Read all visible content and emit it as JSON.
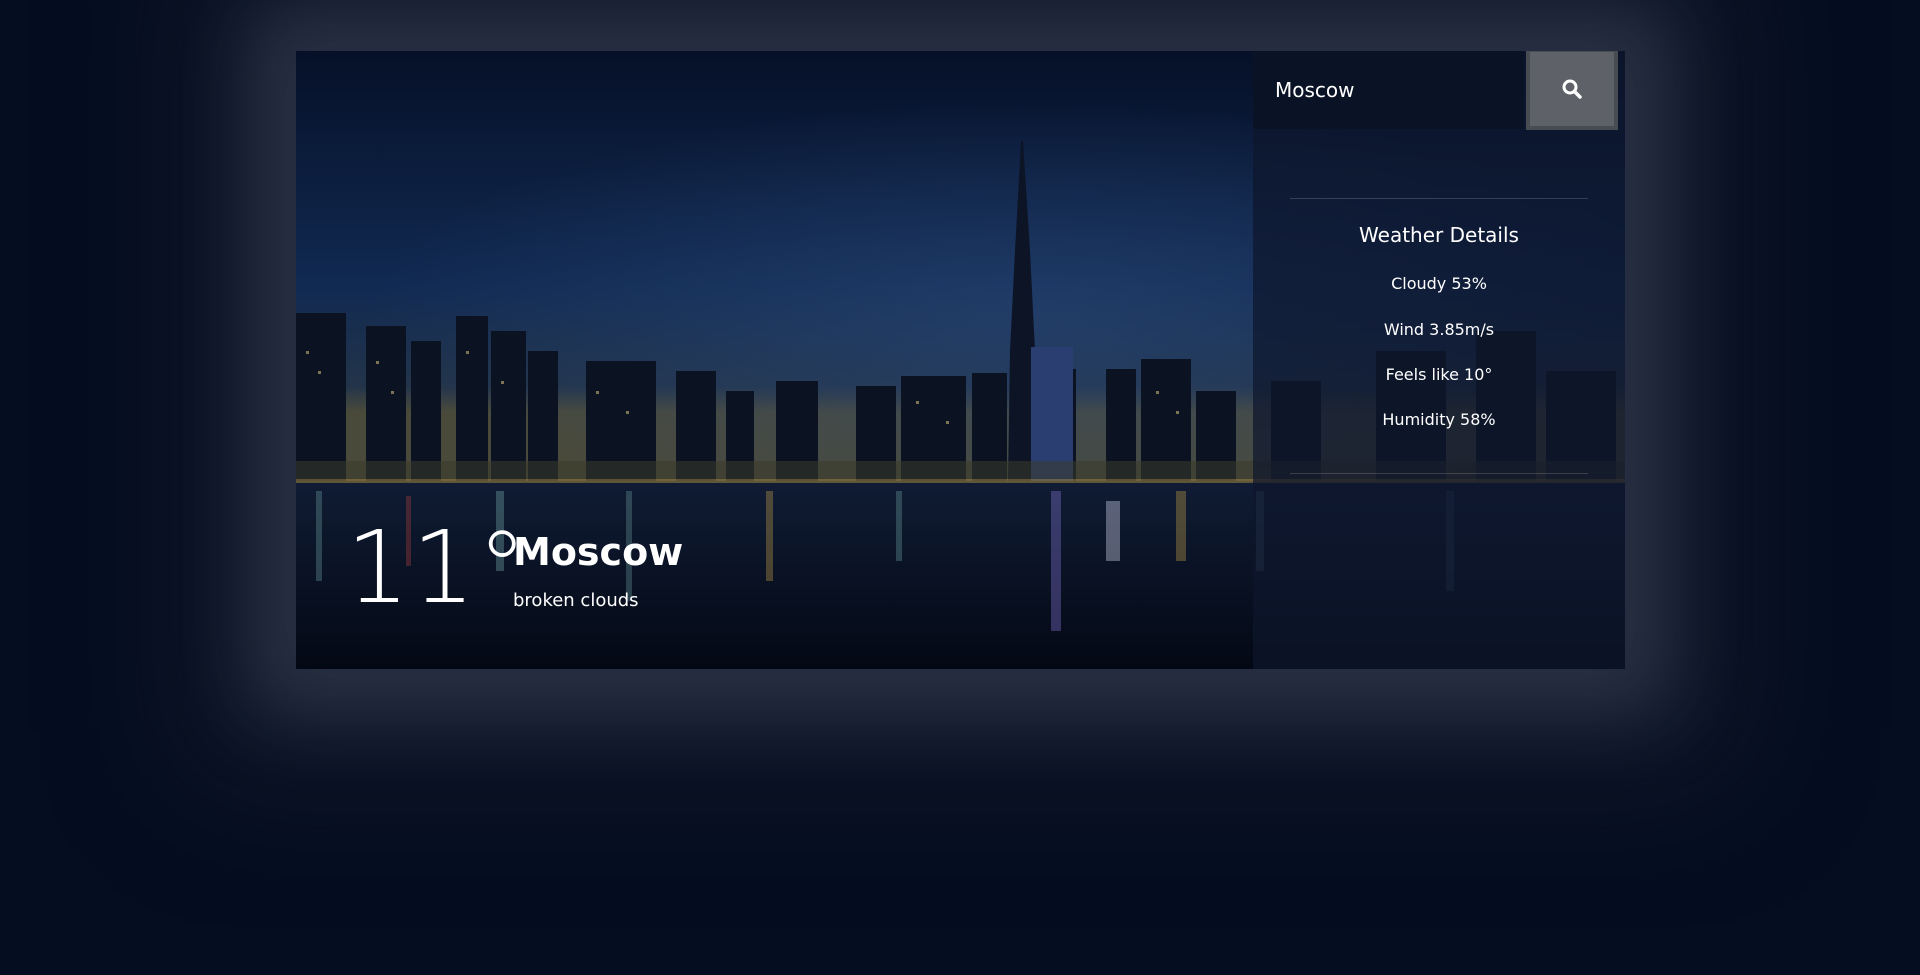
{
  "search": {
    "value": "Moscow",
    "button_icon": "search-icon"
  },
  "details": {
    "title": "Weather Details",
    "cloudy": "Cloudy 53%",
    "wind": "Wind 3.85m/s",
    "feels_like": "Feels like 10°",
    "humidity": "Humidity 58%"
  },
  "current": {
    "temperature": "11°",
    "city": "Moscow",
    "condition": "broken clouds"
  },
  "colors": {
    "background": "#050d20",
    "panel": "#0e162c",
    "search_button": "#5e6268",
    "text": "#ffffff"
  }
}
